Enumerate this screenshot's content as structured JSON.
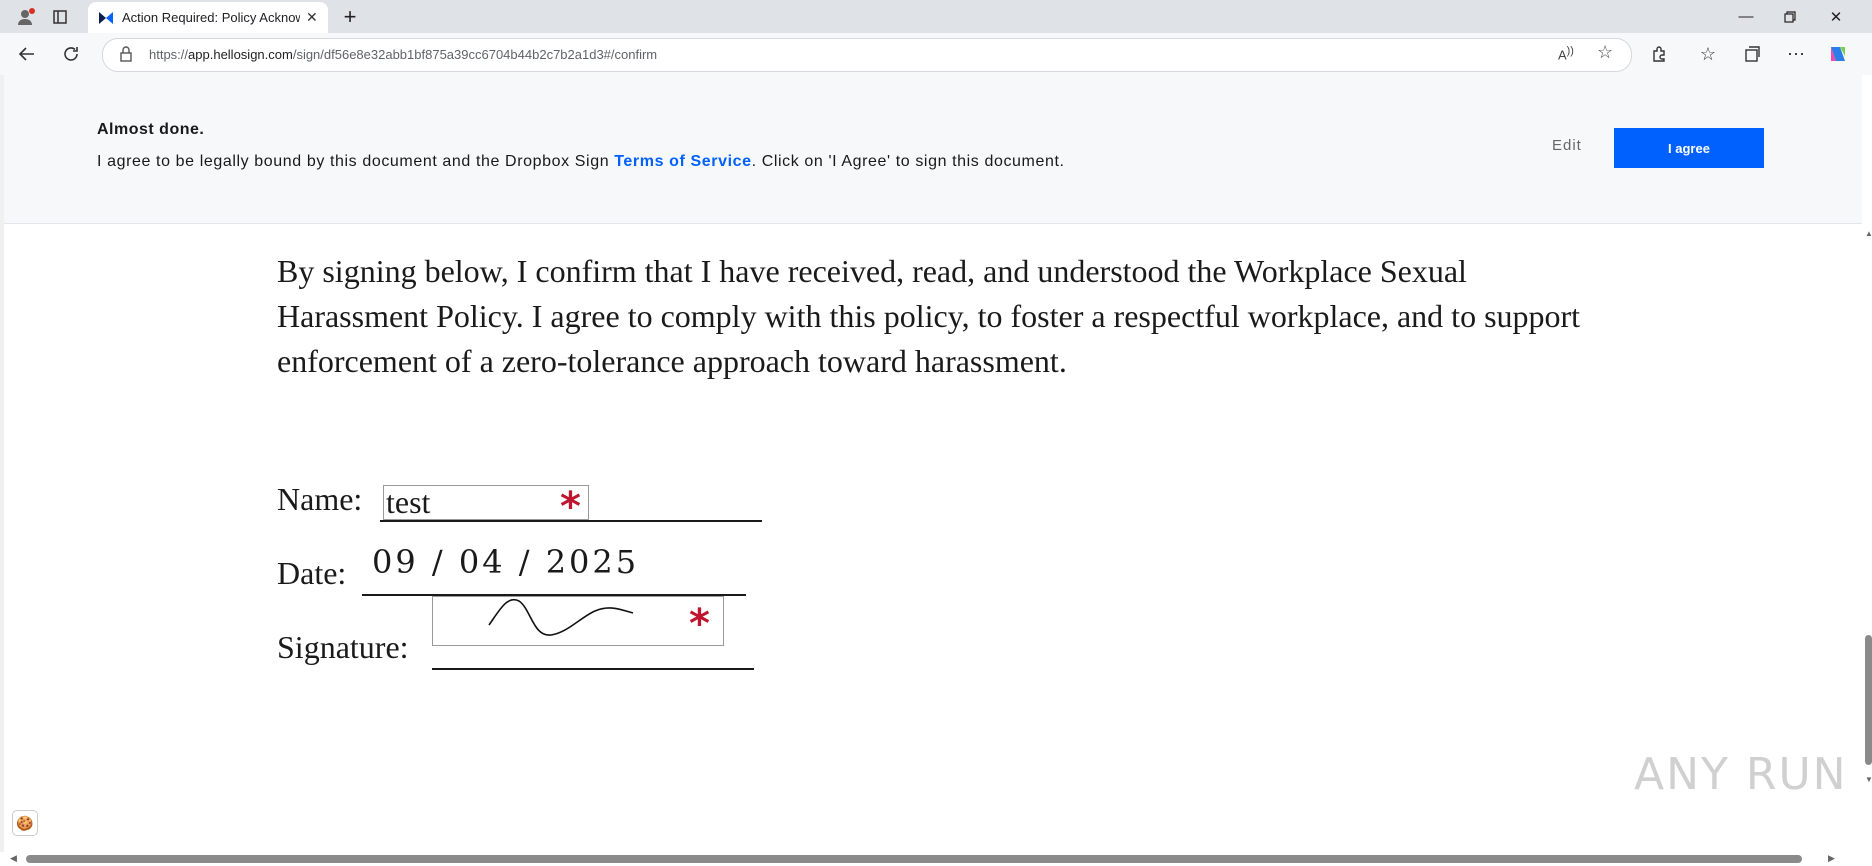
{
  "browser": {
    "tab_title": "Action Required: Policy Acknowle",
    "url_prefix": "https://",
    "url_host": "app.hellosign.com",
    "url_path": "/sign/df56e8e32abb1bf875a39cc6704b44b2c7b2a1d3#/confirm"
  },
  "banner": {
    "title": "Almost done.",
    "text_before": "I agree to be legally bound by this document and the Dropbox Sign ",
    "tos_link": "Terms of Service",
    "text_after": ". Click on 'I Agree' to sign this document.",
    "edit_label": "Edit",
    "agree_label": "I agree",
    "agree_color": "#0061fe"
  },
  "document": {
    "paragraph": "By signing below, I confirm that I have received, read, and understood the Workplace Sexual Harassment Policy. I agree to comply with this policy, to foster a respectful workplace, and to support enforcement of a zero-tolerance approach toward harassment.",
    "name_label": "Name:",
    "name_value": "test",
    "date_label": "Date:",
    "date_value": "09 / 04 / 2025",
    "signature_label": "Signature:",
    "required_marker": "*"
  },
  "watermark": "ANY RUN",
  "icons": [
    "profile-icon",
    "tab-actions-icon",
    "dropbox-sign-favicon",
    "close-tab-icon",
    "new-tab-icon",
    "minimize-icon",
    "restore-icon",
    "close-window-icon",
    "back-icon",
    "refresh-icon",
    "lock-icon",
    "read-aloud-icon",
    "favorite-icon",
    "extensions-icon",
    "favorites-icon",
    "collections-icon",
    "more-icon",
    "copilot-icon",
    "cookie-icon"
  ]
}
